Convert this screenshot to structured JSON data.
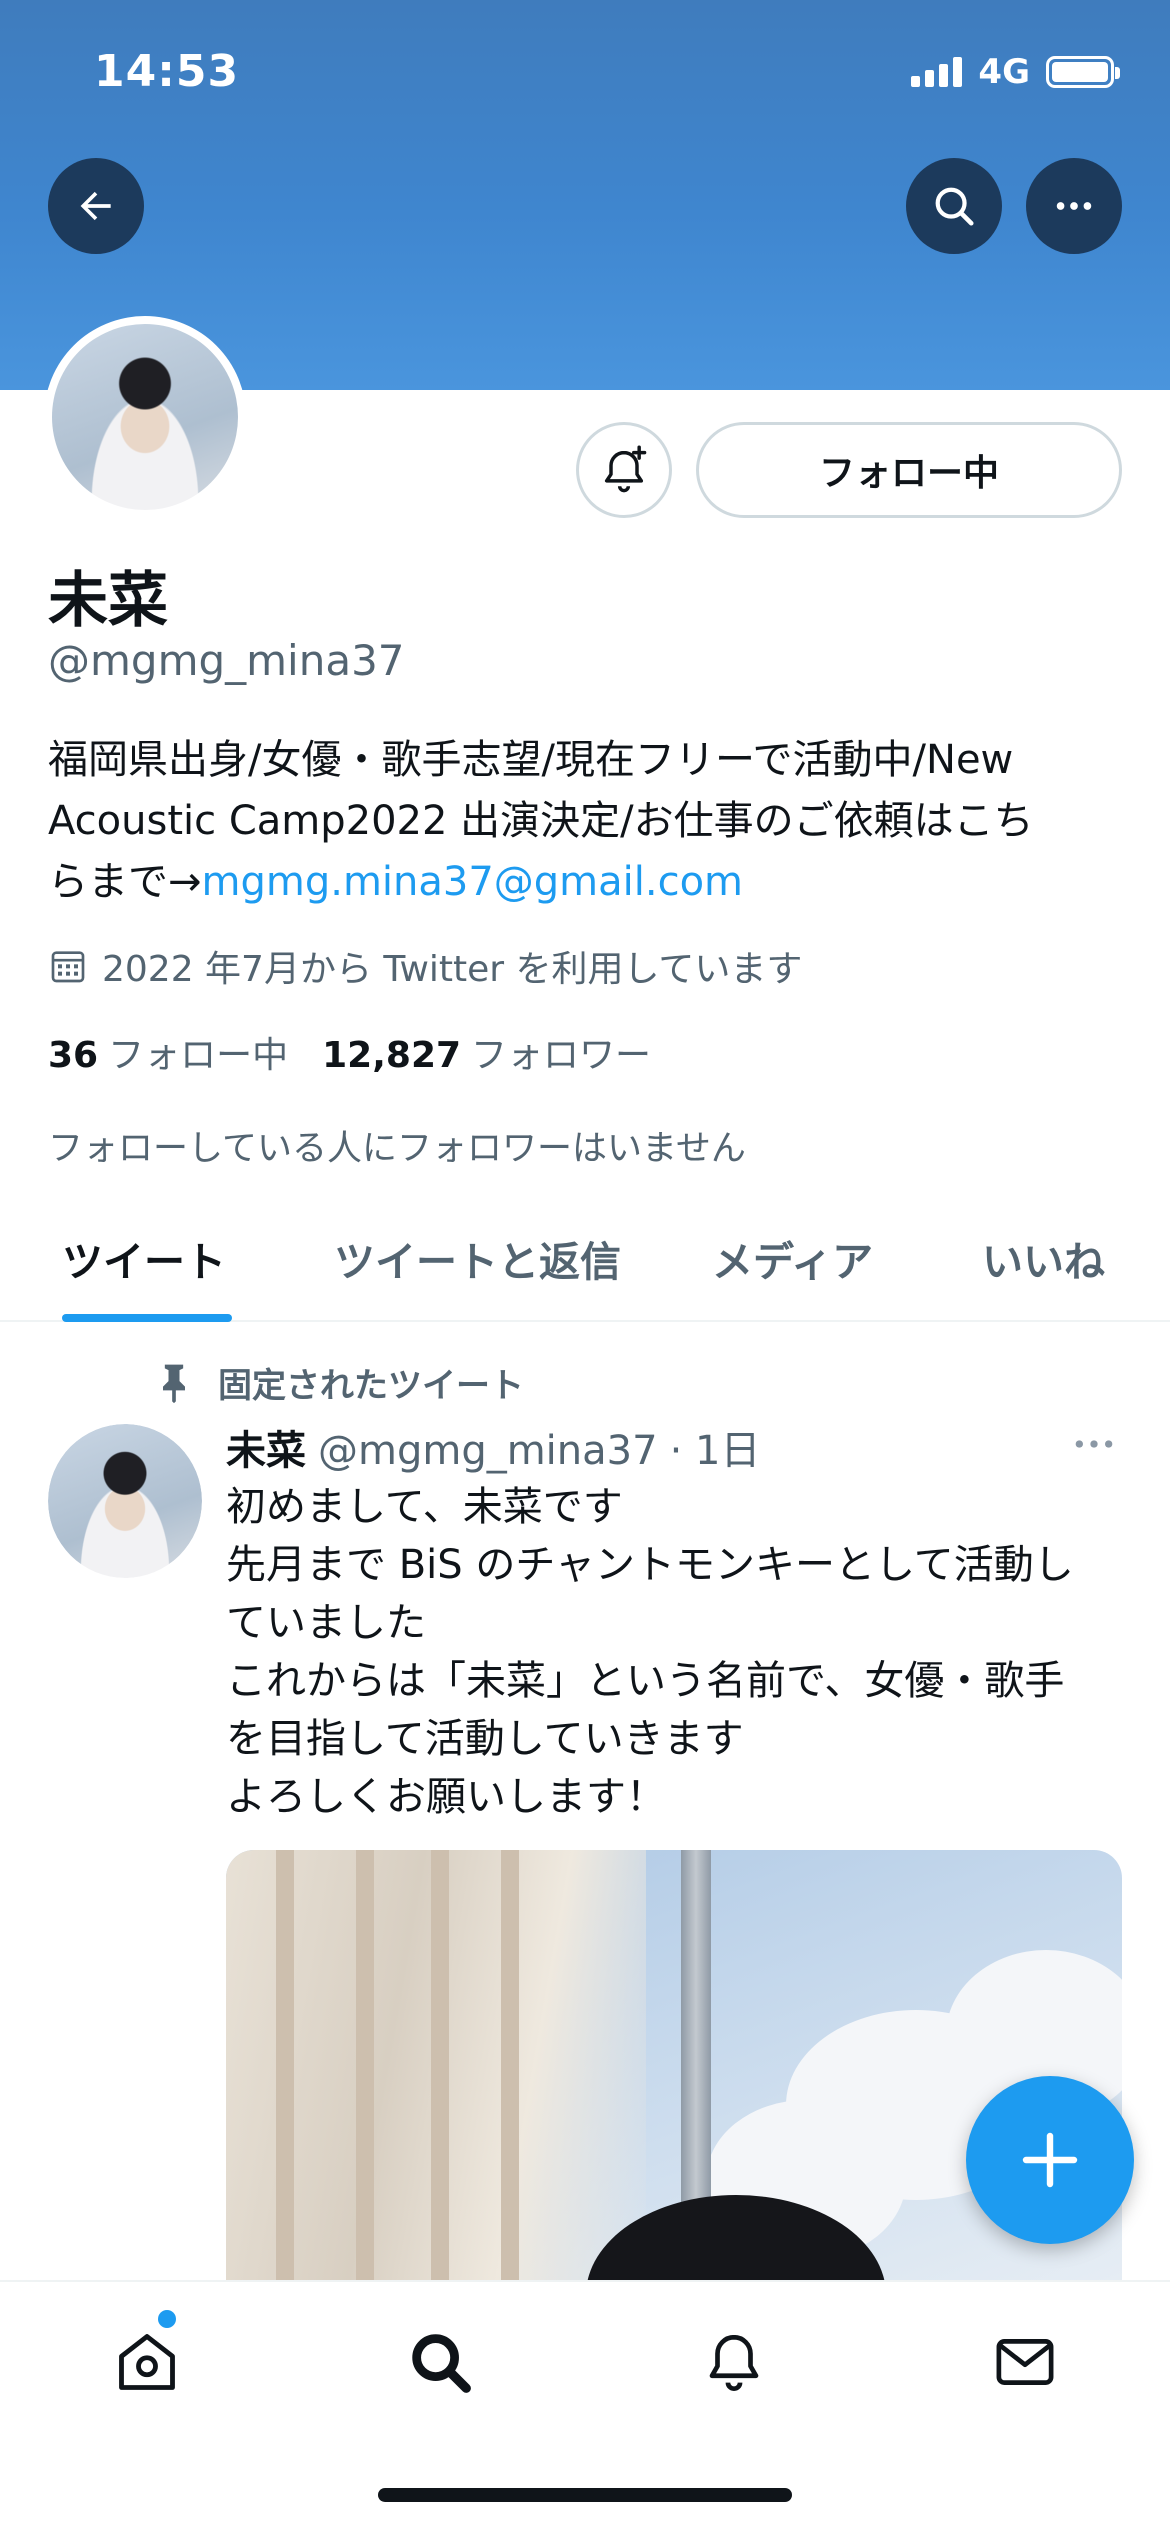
{
  "status_bar": {
    "time": "14:53",
    "network": "4G"
  },
  "header": {
    "back_icon": "arrow-left-icon",
    "search_icon": "search-icon",
    "more_icon": "more-horizontal-icon"
  },
  "profile": {
    "follow_button_label": "フォロー中",
    "name": "未菜",
    "handle": "@mgmg_mina37",
    "bio_line1": "福岡県出身/女優・歌手志望/現在フリーで活動中/New",
    "bio_line2": "Acoustic Camp2022 出演決定/お仕事のご依頼はこち",
    "bio_line3_prefix": "らまで→",
    "bio_email": "mgmg.mina37@gmail.com",
    "joined": "2022 年7月から Twitter を利用しています",
    "following_count": "36",
    "following_label": "フォロー中",
    "followers_count": "12,827",
    "followers_label": "フォロワー",
    "followed_by_note": "フォローしている人にフォロワーはいません"
  },
  "tabs": [
    {
      "label": "ツイート",
      "active": true
    },
    {
      "label": "ツイートと返信",
      "active": false
    },
    {
      "label": "メディア",
      "active": false
    },
    {
      "label": "いいね",
      "active": false
    }
  ],
  "pinned_tweet": {
    "pinned_label": "固定されたツイート",
    "author_name": "未菜",
    "author_handle": "@mgmg_mina37",
    "time": "· 1日",
    "lines": [
      "初めまして、未菜です",
      "先月まで BiS のチャントモンキーとして活動し",
      "ていました",
      "これからは「未菜」という名前で、女優・歌手",
      "を目指して活動していきます",
      "よろしくお願いします！"
    ]
  },
  "colors": {
    "accent": "#1d9bf0",
    "banner": "#3f86cf",
    "text": "#0f1419",
    "secondary": "#536471"
  },
  "bottom_nav": [
    {
      "icon": "home-icon",
      "has_badge": true
    },
    {
      "icon": "search-icon",
      "active": true
    },
    {
      "icon": "bell-icon"
    },
    {
      "icon": "mail-icon"
    }
  ]
}
